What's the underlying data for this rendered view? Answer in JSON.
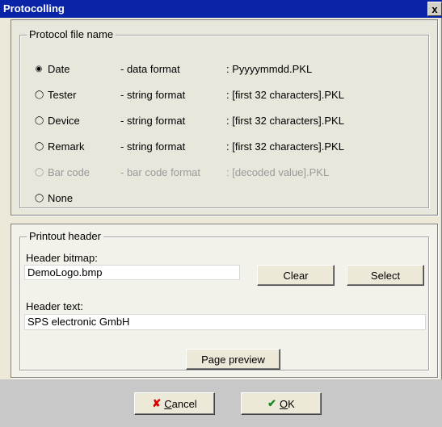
{
  "window": {
    "title": "Protocolling",
    "close_glyph": "x"
  },
  "protocol_file_name": {
    "legend": "Protocol file name",
    "options": [
      {
        "label": "Date",
        "format": "- data format",
        "pattern": ": Pyyyymmdd.PKL",
        "selected": true,
        "enabled": true
      },
      {
        "label": "Tester",
        "format": "- string format",
        "pattern": ": [first 32 characters].PKL",
        "selected": false,
        "enabled": true
      },
      {
        "label": "Device",
        "format": "- string format",
        "pattern": ": [first 32 characters].PKL",
        "selected": false,
        "enabled": true
      },
      {
        "label": "Remark",
        "format": "- string format",
        "pattern": ": [first 32 characters].PKL",
        "selected": false,
        "enabled": true
      },
      {
        "label": "Bar code",
        "format": "- bar code format",
        "pattern": ": [decoded value].PKL",
        "selected": false,
        "enabled": false
      },
      {
        "label": "None",
        "format": "",
        "pattern": "",
        "selected": false,
        "enabled": true
      }
    ]
  },
  "printout_header": {
    "legend": "Printout header",
    "bitmap_label": "Header bitmap:",
    "bitmap_value": "DemoLogo.bmp",
    "clear_label": "Clear",
    "select_label": "Select",
    "text_label": "Header text:",
    "text_value": "SPS electronic GmbH",
    "preview_label": "Page preview"
  },
  "footer": {
    "cancel_icon": "✘",
    "cancel_first": "C",
    "cancel_rest": "ancel",
    "ok_icon": "✔",
    "ok_first": "O",
    "ok_rest": "K"
  },
  "colors": {
    "titlebar": "#0a24a8",
    "cancel_icon": "#d40000",
    "ok_icon": "#1a8a1a"
  }
}
